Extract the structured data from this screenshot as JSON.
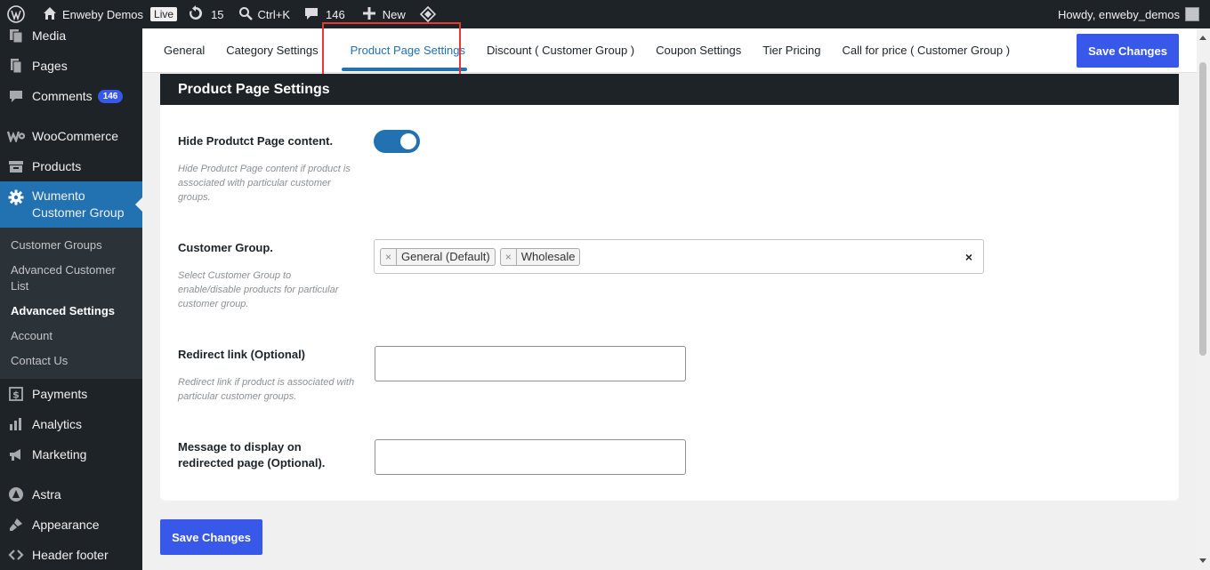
{
  "adminbar": {
    "site_name": "Enweby Demos",
    "live_badge": "Live",
    "updates_count": "15",
    "search_shortcut": "Ctrl+K",
    "comments_count": "146",
    "new_label": "New",
    "howdy": "Howdy, enweby_demos"
  },
  "sidebar": {
    "media": "Media",
    "pages": "Pages",
    "comments": "Comments",
    "comments_badge": "146",
    "woocommerce": "WooCommerce",
    "products": "Products",
    "wumento_line1": "Wumento",
    "wumento_line2": "Customer Group",
    "submenu": [
      "Customer Groups",
      "Advanced Customer List",
      "Advanced Settings",
      "Account",
      "Contact Us"
    ],
    "payments": "Payments",
    "analytics": "Analytics",
    "marketing": "Marketing",
    "astra": "Astra",
    "appearance": "Appearance",
    "header_footer": "Header footer"
  },
  "tabs": [
    "General",
    "Category Settings",
    "Product Page Settings",
    "Discount ( Customer Group )",
    "Coupon Settings",
    "Tier Pricing",
    "Call for price ( Customer Group )"
  ],
  "save_label": "Save Changes",
  "panel": {
    "title": "Product Page Settings",
    "hide_label": "Hide Produtct Page content.",
    "hide_help": "Hide Produtct Page content if product is associated with particular customer groups.",
    "hide_enabled": true,
    "group_label": "Customer Group.",
    "group_help": "Select Customer Group to enable/disable products for particular customer group.",
    "group_chips": [
      "General (Default)",
      "Wholesale"
    ],
    "chip_remove": "×",
    "clear_all": "×",
    "redirect_label": "Redirect link (Optional)",
    "redirect_help": "Redirect link if product is associated with particular customer groups.",
    "redirect_value": "",
    "message_label": "Message to display on redirected page (Optional).",
    "message_value": ""
  },
  "colors": {
    "accent": "#2271b1",
    "button": "#3858e9",
    "highlight": "#e53935",
    "dark": "#1d2327"
  }
}
